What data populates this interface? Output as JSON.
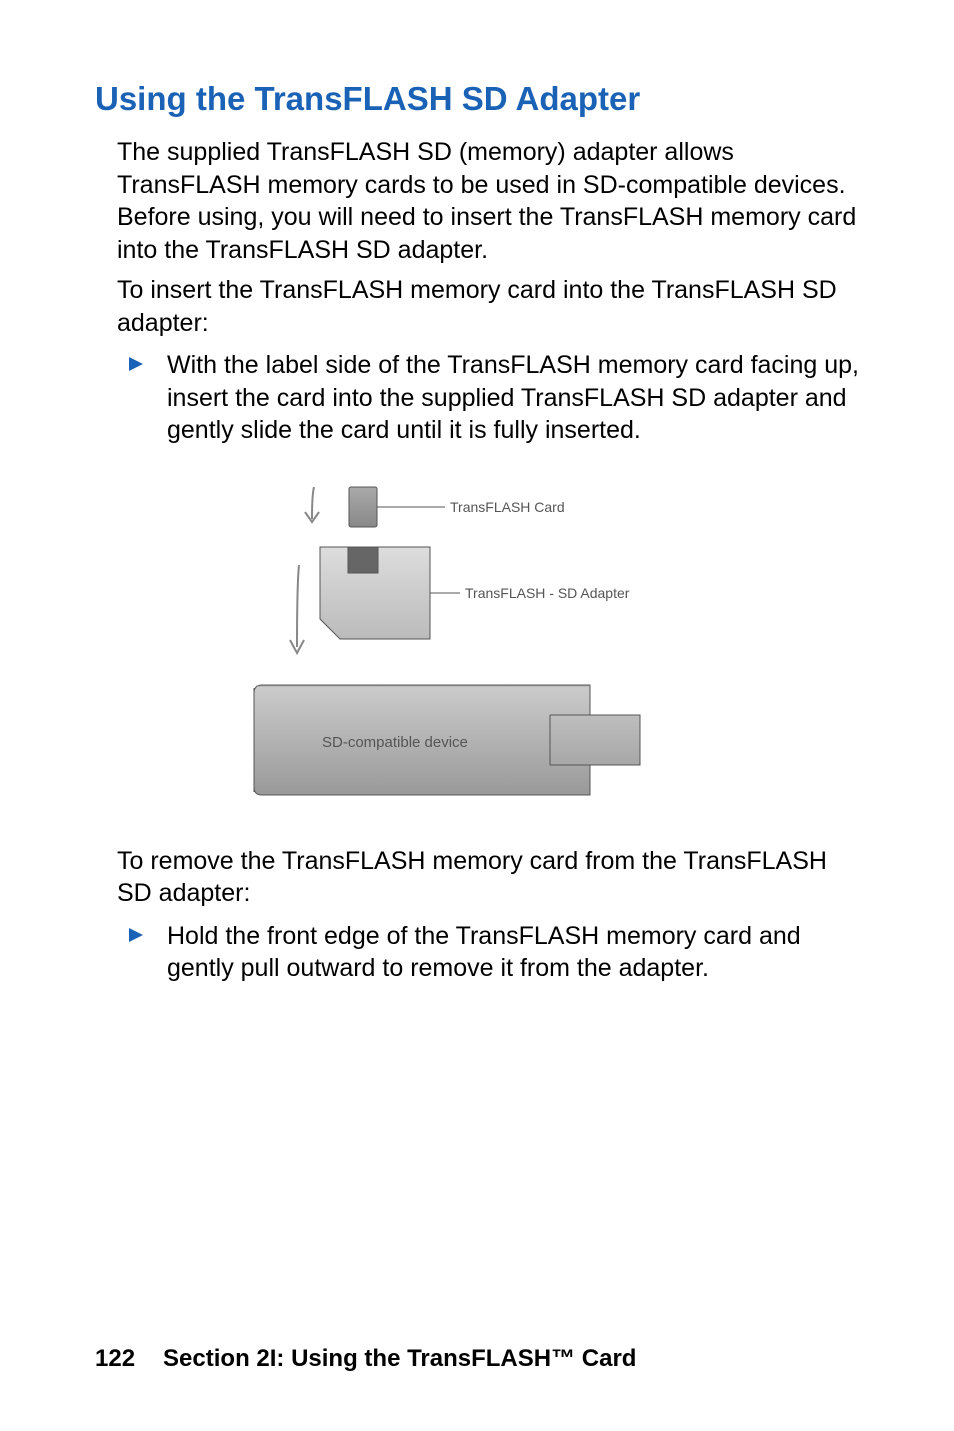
{
  "heading": "Using the TransFLASH SD Adapter",
  "intro": "The supplied TransFLASH SD (memory) adapter allows TransFLASH memory cards to be used in SD-compatible devices. Before using, you will need to insert the TransFLASH memory card into the TransFLASH SD adapter.",
  "insert_head": "To insert the TransFLASH memory card into the TransFLASH SD adapter:",
  "insert_item": "With the label side of the TransFLASH memory card facing up, insert the card into the supplied TransFLASH SD adapter and gently slide the card until it is fully inserted.",
  "figure": {
    "label_card": "TransFLASH Card",
    "label_adapter": "TransFLASH - SD Adapter",
    "label_device": "SD-compatible device"
  },
  "remove_head": "To remove the TransFLASH memory card from the TransFLASH SD adapter:",
  "remove_item": "Hold the front edge of the TransFLASH memory card and gently pull outward to remove it from the adapter.",
  "footer": {
    "page_num": "122",
    "section": "Section 2I: Using the TransFLASH™ Card"
  }
}
